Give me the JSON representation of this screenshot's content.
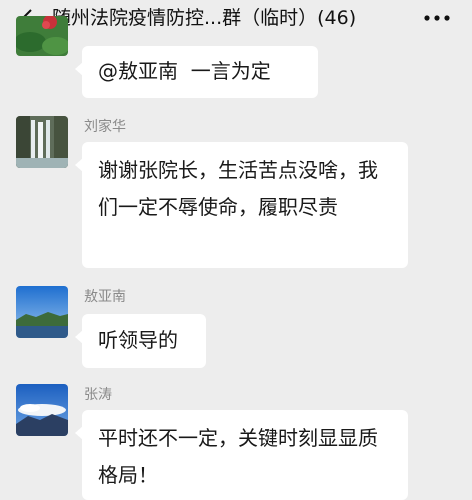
{
  "header": {
    "title": "随州法院疫情防控...群（临时）(46)",
    "back_icon": "chevron-left-icon",
    "more_icon": "more-dots-icon"
  },
  "messages": [
    {
      "sender": "",
      "text": "@敖亚南  一言为定",
      "avatar": "flower-avatar"
    },
    {
      "sender": "刘家华",
      "text": "谢谢张院长，生活苦点没啥，我们一定不辱使命，履职尽责",
      "avatar": "waterfall-avatar"
    },
    {
      "sender": "敖亚南",
      "text": "听领导的",
      "avatar": "mountain-lake-avatar"
    },
    {
      "sender": "张涛",
      "text": "平时还不一定，关键时刻显显质格局！",
      "avatar": "snow-mountain-avatar"
    }
  ],
  "colors": {
    "background": "#ededed",
    "bubble": "#ffffff",
    "sender_text": "#8a8a8a"
  }
}
